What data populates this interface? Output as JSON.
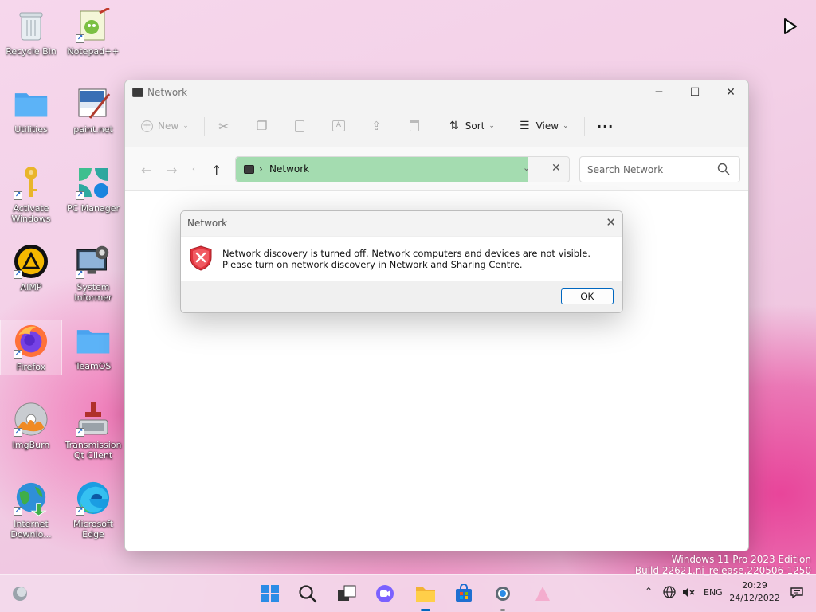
{
  "desktop": {
    "icons": [
      {
        "label": "Recycle Bin"
      },
      {
        "label": "Notepad++"
      },
      {
        "label": "Utilities"
      },
      {
        "label": "paint.net"
      },
      {
        "label": "Activate Windows"
      },
      {
        "label": "PC Manager"
      },
      {
        "label": "AIMP"
      },
      {
        "label": "System Informer"
      },
      {
        "label": "Firefox"
      },
      {
        "label": "TeamOS"
      },
      {
        "label": "ImgBurn"
      },
      {
        "label": "Transmission Qt Client"
      },
      {
        "label": "Internet Downlo..."
      },
      {
        "label": "Microsoft Edge"
      }
    ]
  },
  "explorer": {
    "title": "Network",
    "toolbar": {
      "new_label": "New",
      "sort_label": "Sort",
      "view_label": "View"
    },
    "address": {
      "crumb": "Network"
    },
    "search": {
      "placeholder": "Search Network"
    }
  },
  "dialog": {
    "title": "Network",
    "message": "Network discovery is turned off. Network computers and devices are not visible. Please turn on network discovery in Network and Sharing Centre.",
    "ok_label": "OK"
  },
  "watermark": {
    "line1": "Windows 11 Pro 2023 Edition",
    "line2": "Build 22621.ni_release.220506-1250"
  },
  "taskbar": {
    "language": "ENG",
    "time": "20:29",
    "date": "24/12/2022"
  },
  "colors": {
    "accent": "#0067c0",
    "address_highlight": "#a4dcb0",
    "error_red": "#e0323c"
  }
}
